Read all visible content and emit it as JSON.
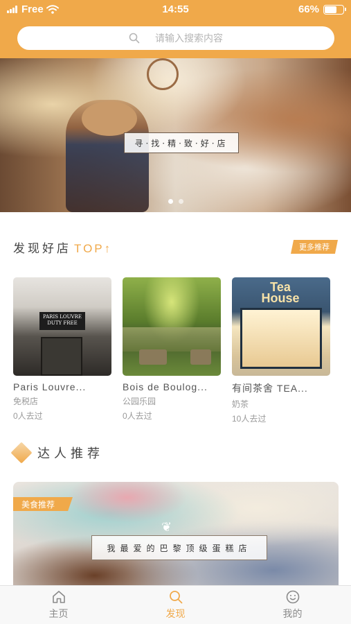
{
  "status_bar": {
    "carrier": "Free",
    "time": "14:55",
    "battery": "66%",
    "battery_level": 0.66
  },
  "search": {
    "placeholder": "请输入搜索内容",
    "icon": "search-icon"
  },
  "banner": {
    "caption": "寻·找·精·致·好·店",
    "dots": [
      {
        "active": true
      },
      {
        "active": false
      }
    ]
  },
  "discover": {
    "title": "发现好店",
    "title_accent": "TOP↑",
    "more_label": "更多推荐",
    "shops": [
      {
        "name": "Paris Louvre...",
        "category": "免税店",
        "visits": "0人去过",
        "image_text": "PARIS LOUVRE\nDUTY FREE"
      },
      {
        "name": "Bois de Boulog...",
        "category": "公园乐园",
        "visits": "0人去过"
      },
      {
        "name": "有间茶舍 TEA...",
        "category": "奶茶",
        "visits": "10人去过",
        "image_text": "Tea House"
      }
    ]
  },
  "expert": {
    "title": "达人推荐",
    "feature": {
      "tag": "美食推荐",
      "caption": "我最爱的巴黎顶级蛋糕店"
    }
  },
  "tabbar": {
    "items": [
      {
        "label": "主页",
        "icon": "home-icon",
        "active": false
      },
      {
        "label": "发现",
        "icon": "search-icon",
        "active": true
      },
      {
        "label": "我的",
        "icon": "smiley-icon",
        "active": false
      }
    ]
  },
  "colors": {
    "accent": "#f0a94a",
    "text": "#444444",
    "muted": "#9a9a9a"
  }
}
